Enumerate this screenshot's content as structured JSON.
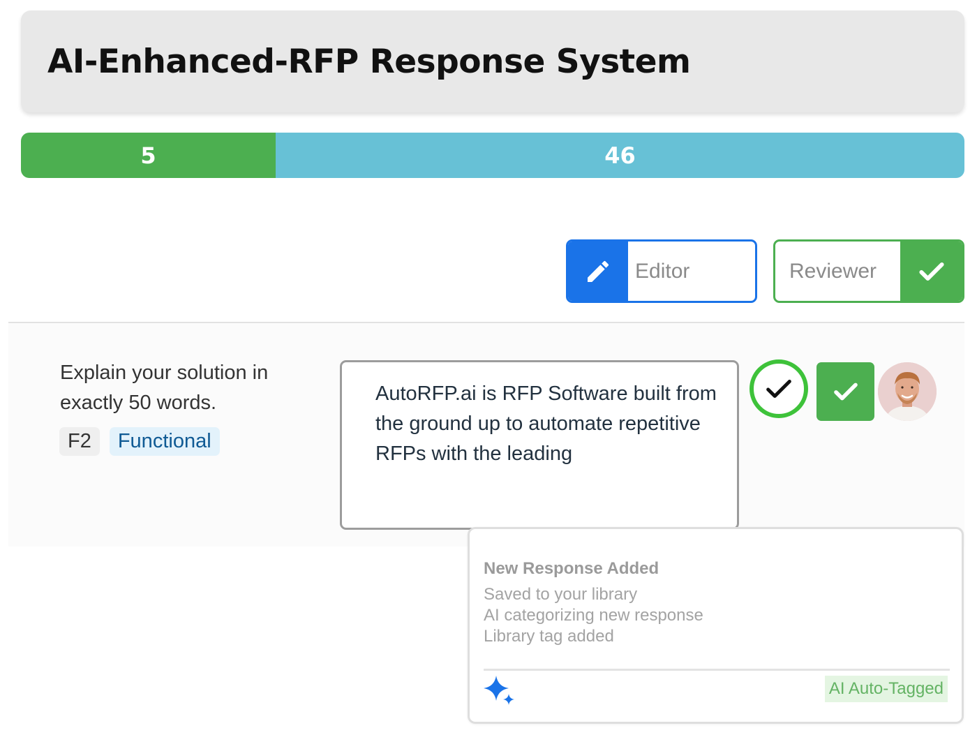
{
  "header": {
    "title": "AI-Enhanced-RFP Response System"
  },
  "progress": {
    "completed": "5",
    "remaining": "46",
    "completed_fraction": 0.27,
    "colors": {
      "completed": "#4caf50",
      "remaining": "#67c1d6"
    }
  },
  "roles": {
    "editor": {
      "label": "Editor",
      "icon": "pencil-icon",
      "color": "#1a73e8"
    },
    "reviewer": {
      "label": "Reviewer",
      "icon": "check-icon",
      "color": "#4caf50"
    }
  },
  "question": {
    "text": "Explain your solution in exactly 50 words.",
    "tag_id": "F2",
    "tag_type": "Functional"
  },
  "answer": {
    "text": "AutoRFP.ai is RFP Software built from the ground up to automate repetitive RFPs with the leading"
  },
  "status": {
    "ring_icon": "check-circle-icon",
    "approve_icon": "check-icon",
    "avatar": "reviewer-avatar"
  },
  "notification": {
    "title": "New Response Added",
    "lines": [
      "Saved to your library",
      "AI categorizing new response",
      "Library tag added"
    ],
    "badge": "AI Auto-Tagged",
    "icon": "sparkle-icon"
  }
}
